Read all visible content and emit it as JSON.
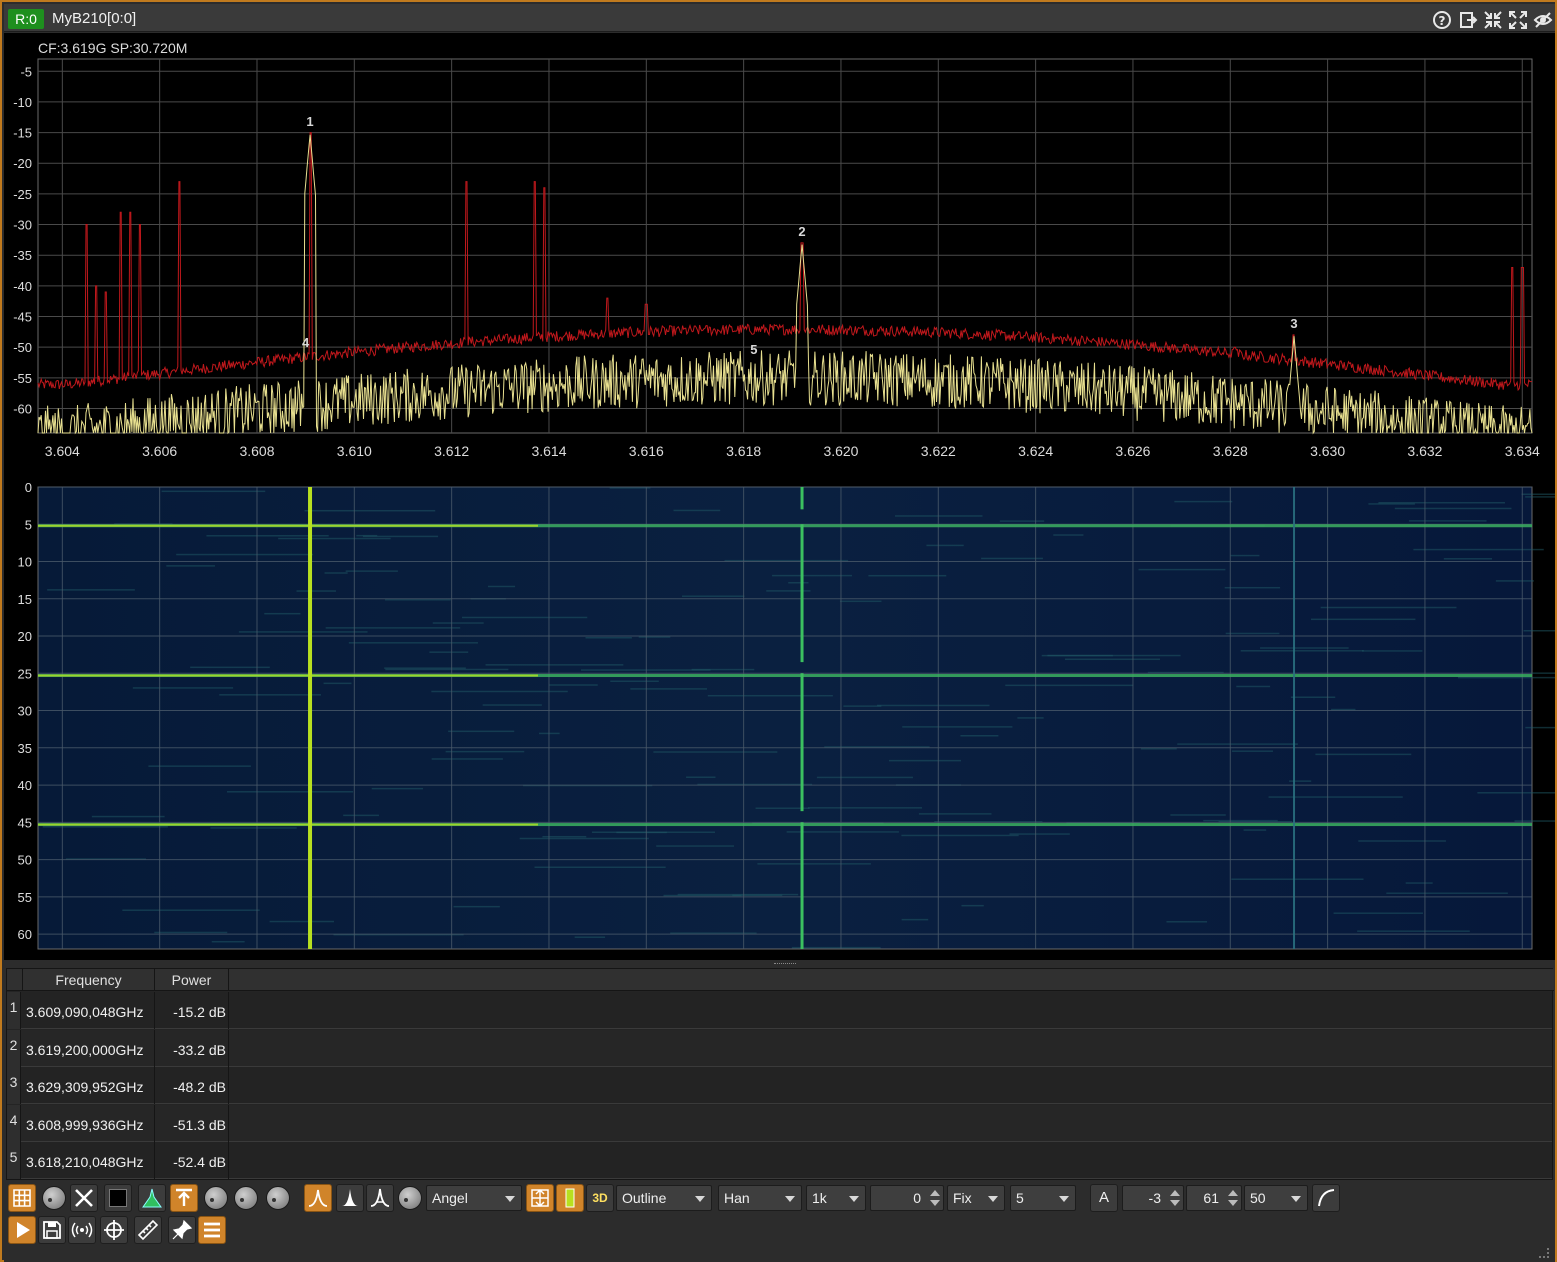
{
  "window": {
    "rx_badge": "R:0",
    "title": "MyB210[0:0]",
    "buttons": [
      "help-icon",
      "detach-icon",
      "shrink-icon",
      "expand-icon",
      "hide-icon"
    ]
  },
  "spectrum": {
    "info_label": "CF:3.619G SP:30.720M",
    "y_ticks": [
      "-5",
      "-10",
      "-15",
      "-20",
      "-25",
      "-30",
      "-35",
      "-40",
      "-45",
      "-50",
      "-55",
      "-60"
    ],
    "x_ticks": [
      "3.604",
      "3.606",
      "3.608",
      "3.610",
      "3.612",
      "3.614",
      "3.616",
      "3.618",
      "3.620",
      "3.622",
      "3.624",
      "3.626",
      "3.628",
      "3.630",
      "3.632",
      "3.634"
    ],
    "x_range_ghz": [
      3.6035,
      3.6342
    ],
    "y_range_db": [
      -64,
      -3
    ],
    "marker_labels": [
      "1",
      "2",
      "3",
      "4",
      "5"
    ],
    "marker_positions": [
      {
        "freq": 3.60909,
        "power": -15.2
      },
      {
        "freq": 3.6192,
        "power": -33.2
      },
      {
        "freq": 3.62931,
        "power": -48.2
      },
      {
        "freq": 3.609,
        "power": -51.3
      },
      {
        "freq": 3.61821,
        "power": -52.4
      }
    ],
    "colors": {
      "max_hold": "#c0181c",
      "live": "#e8e090",
      "grid": "#4a4a4a"
    }
  },
  "waterfall": {
    "y_ticks": [
      "0",
      "5",
      "10",
      "15",
      "20",
      "25",
      "30",
      "35",
      "40",
      "45",
      "50",
      "55",
      "60"
    ],
    "colors": {
      "background": "#0a1a33",
      "signal": "#b8e020"
    }
  },
  "marker_table": {
    "headers": [
      "Frequency",
      "Power"
    ],
    "rows": [
      {
        "index": "1",
        "frequency": "3.609,090,048GHz",
        "power": "-15.2 dB"
      },
      {
        "index": "2",
        "frequency": "3.619,200,000GHz",
        "power": "-33.2 dB"
      },
      {
        "index": "3",
        "frequency": "3.629,309,952GHz",
        "power": "-48.2 dB"
      },
      {
        "index": "4",
        "frequency": "3.608,999,936GHz",
        "power": "-51.3 dB"
      },
      {
        "index": "5",
        "frequency": "3.618,210,048GHz",
        "power": "-52.4 dB"
      }
    ]
  },
  "toolbar": {
    "palette_combo": "Angel",
    "trace_mode_combo": "Outline",
    "window_combo": "Han",
    "fft_size_combo": "1k",
    "ref_spin": "0",
    "scale_combo": "Fix",
    "range_combo": "5",
    "a_button": "A",
    "min_spin": "-3",
    "max_spin": "61",
    "rate_combo": "50",
    "label_3d": "3D"
  }
}
